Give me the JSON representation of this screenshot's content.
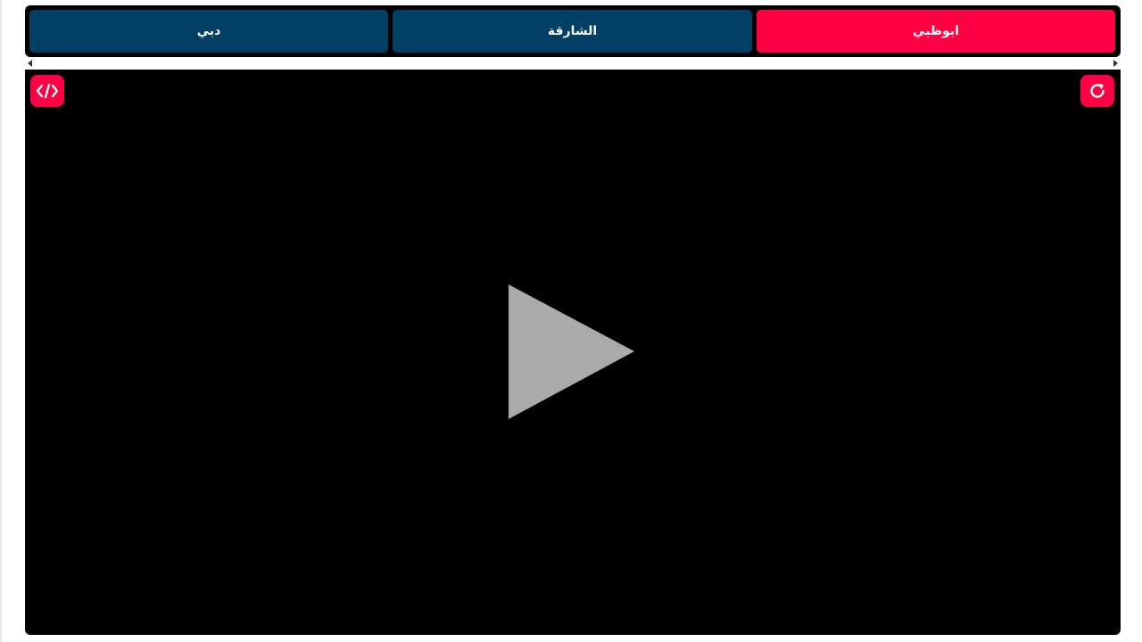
{
  "colors": {
    "accent": "#ff0044",
    "tab_inactive": "#023f65",
    "player_bg": "#000000",
    "play_icon": "#aaaaaa"
  },
  "tabs": [
    {
      "label": "دبي",
      "active": false
    },
    {
      "label": "الشارقة",
      "active": false
    },
    {
      "label": "ابوظبي",
      "active": true
    }
  ],
  "player": {
    "left_control_icon": "code-embed-icon",
    "right_control_icon": "reload-icon",
    "center_icon": "play-icon"
  }
}
